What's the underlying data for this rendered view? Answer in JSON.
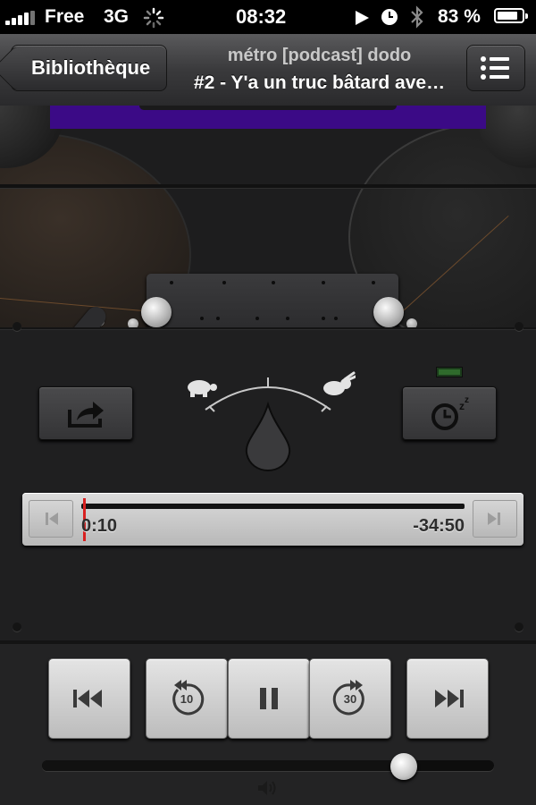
{
  "status_bar": {
    "carrier": "Free",
    "network": "3G",
    "time": "08:32",
    "battery_percent": "83 %",
    "battery_level": 0.83
  },
  "nav": {
    "back_label": "Bibliothèque",
    "podcast_title": "métro [podcast] dodo",
    "episode_title": "#2 - Y'a un truc bâtard ave…"
  },
  "progress": {
    "elapsed": "0:10",
    "remaining": "-34:50",
    "fraction": 0.005
  },
  "controls": {
    "skip_back_seconds": "10",
    "skip_forward_seconds": "30",
    "volume_level": 0.8
  },
  "icons": {
    "back": "chevron-left-icon",
    "list": "list-icon",
    "share": "share-icon",
    "sleep_timer": "sleep-timer-icon",
    "speed_slow": "turtle-icon",
    "speed_fast": "rabbit-icon",
    "volume": "speaker-icon"
  },
  "colors": {
    "accent_playhead": "#d82020",
    "screen_purple": "#3b0a86",
    "led_green": "#2f6b2c"
  }
}
